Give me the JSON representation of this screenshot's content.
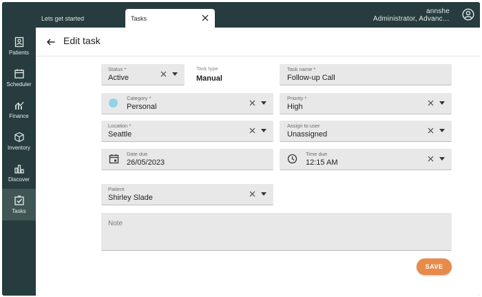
{
  "tabs": [
    {
      "label": "Lets get started"
    },
    {
      "label": "Tasks"
    }
  ],
  "user": {
    "name": "annshe",
    "role": "Administrator, Advanc…"
  },
  "sidebar": {
    "items": [
      {
        "label": "Patients",
        "icon": "patients-icon"
      },
      {
        "label": "Scheduler",
        "icon": "calendar-icon"
      },
      {
        "label": "Finance",
        "icon": "finance-icon"
      },
      {
        "label": "Inventory",
        "icon": "box-icon"
      },
      {
        "label": "Discover",
        "icon": "bar-chart-icon"
      },
      {
        "label": "Tasks",
        "icon": "checkbox-icon",
        "active": true
      }
    ]
  },
  "page": {
    "title": "Edit task"
  },
  "form": {
    "status": {
      "label": "Status *",
      "value": "Active"
    },
    "task_type": {
      "label": "Task type",
      "value": "Manual"
    },
    "task_name": {
      "label": "Task name *",
      "value": "Follow-up Call"
    },
    "category": {
      "label": "Category *",
      "value": "Personal",
      "color": "#8fd3e8"
    },
    "priority": {
      "label": "Priority *",
      "value": "High"
    },
    "location": {
      "label": "Location *",
      "value": "Seattle"
    },
    "assign_to": {
      "label": "Assign to user",
      "value": "Unassigned"
    },
    "date_due": {
      "label": "Date due",
      "value": "26/05/2023"
    },
    "time_due": {
      "label": "Time due",
      "value": "12:15 AM"
    },
    "patient": {
      "label": "Patient",
      "value": "Shirley Slade"
    },
    "note": {
      "placeholder": "Note"
    }
  },
  "actions": {
    "save_label": "SAVE"
  },
  "colors": {
    "sidebar": "#263c3e",
    "accent": "#e88a4a",
    "field_bg": "#e8e8e8"
  }
}
